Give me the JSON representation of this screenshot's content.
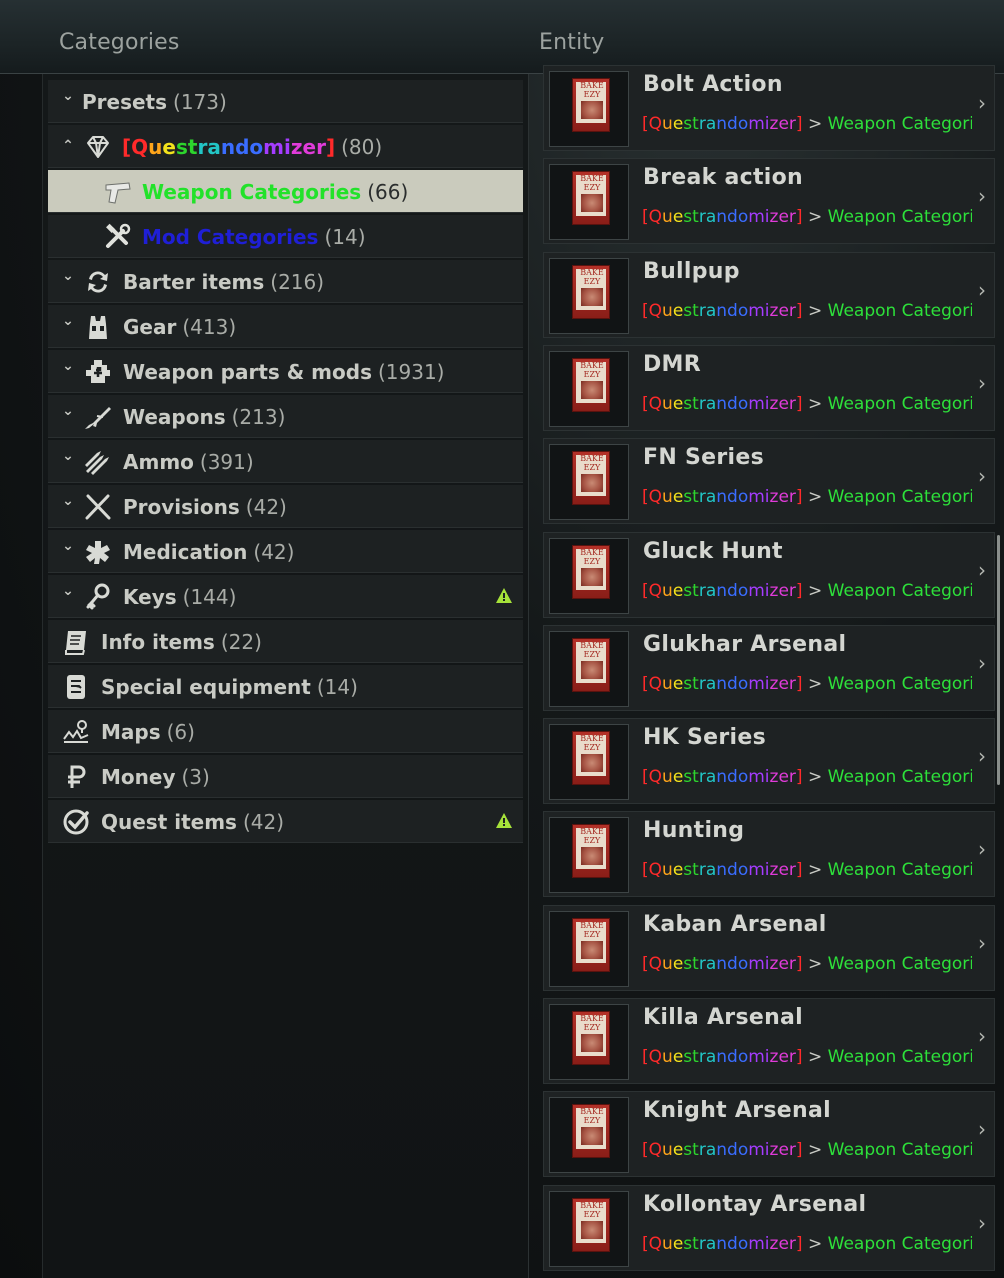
{
  "header": {
    "categories_title": "Categories",
    "entity_title": "Entity"
  },
  "categories": [
    {
      "label": "Presets",
      "count": "(173)",
      "icon": "presets-icon",
      "expanded": false
    },
    {
      "label": "[Questrandomizer]",
      "count": "(80)",
      "icon": "diamond-icon",
      "expanded": true
    },
    {
      "label": "Weapon Categories",
      "count": "(66)",
      "icon": "pistol-icon",
      "selected": true
    },
    {
      "label": "Mod Categories",
      "count": "(14)",
      "icon": "tools-icon"
    },
    {
      "label": "Barter items",
      "count": "(216)",
      "icon": "barter-icon"
    },
    {
      "label": "Gear",
      "count": "(413)",
      "icon": "gear-vest-icon"
    },
    {
      "label": "Weapon parts & mods",
      "count": "(1931)",
      "icon": "weapon-parts-icon"
    },
    {
      "label": "Weapons",
      "count": "(213)",
      "icon": "rifle-icon"
    },
    {
      "label": "Ammo",
      "count": "(391)",
      "icon": "ammo-icon"
    },
    {
      "label": "Provisions",
      "count": "(42)",
      "icon": "utensils-icon"
    },
    {
      "label": "Medication",
      "count": "(42)",
      "icon": "medication-icon"
    },
    {
      "label": "Keys",
      "count": "(144)",
      "icon": "keys-icon",
      "warning": true
    },
    {
      "label": "Info items",
      "count": "(22)",
      "icon": "info-items-icon"
    },
    {
      "label": "Special equipment",
      "count": "(14)",
      "icon": "special-equipment-icon"
    },
    {
      "label": "Maps",
      "count": "(6)",
      "icon": "maps-icon"
    },
    {
      "label": "Money",
      "count": "(3)",
      "icon": "ruble-icon"
    },
    {
      "label": "Quest items",
      "count": "(42)",
      "icon": "quest-check-icon",
      "warning": true
    }
  ],
  "rainbow_word": {
    "text": "[Questrandomizer]",
    "colors": [
      "#ff2a2a",
      "#ff2a2a",
      "#ffa51a",
      "#f2e21c",
      "#2dd52d",
      "#2dd52d",
      "#22c6c6",
      "#22c6c6",
      "#3a6dff",
      "#3a6dff",
      "#3a6dff",
      "#a43cff",
      "#a43cff",
      "#e03bd9",
      "#e03bd9",
      "#e03bd9",
      "#ff2a2a"
    ]
  },
  "path": {
    "separator": ">",
    "tail": "Weapon Categori"
  },
  "entities": [
    {
      "name": "Bolt Action"
    },
    {
      "name": "Break action"
    },
    {
      "name": "Bullpup"
    },
    {
      "name": "DMR"
    },
    {
      "name": "FN Series"
    },
    {
      "name": "Gluck Hunt"
    },
    {
      "name": "Glukhar Arsenal"
    },
    {
      "name": "HK Series"
    },
    {
      "name": "Hunting"
    },
    {
      "name": "Kaban Arsenal"
    },
    {
      "name": "Killa Arsenal"
    },
    {
      "name": "Knight Arsenal"
    },
    {
      "name": "Kollontay Arsenal"
    }
  ],
  "thumbnail_text": "BAKE EZY",
  "colors": {
    "selected_label": "#22e22a",
    "mod_label": "#1f1fd6",
    "path_tail": "#2de03a",
    "warning": "#a6e23a"
  }
}
